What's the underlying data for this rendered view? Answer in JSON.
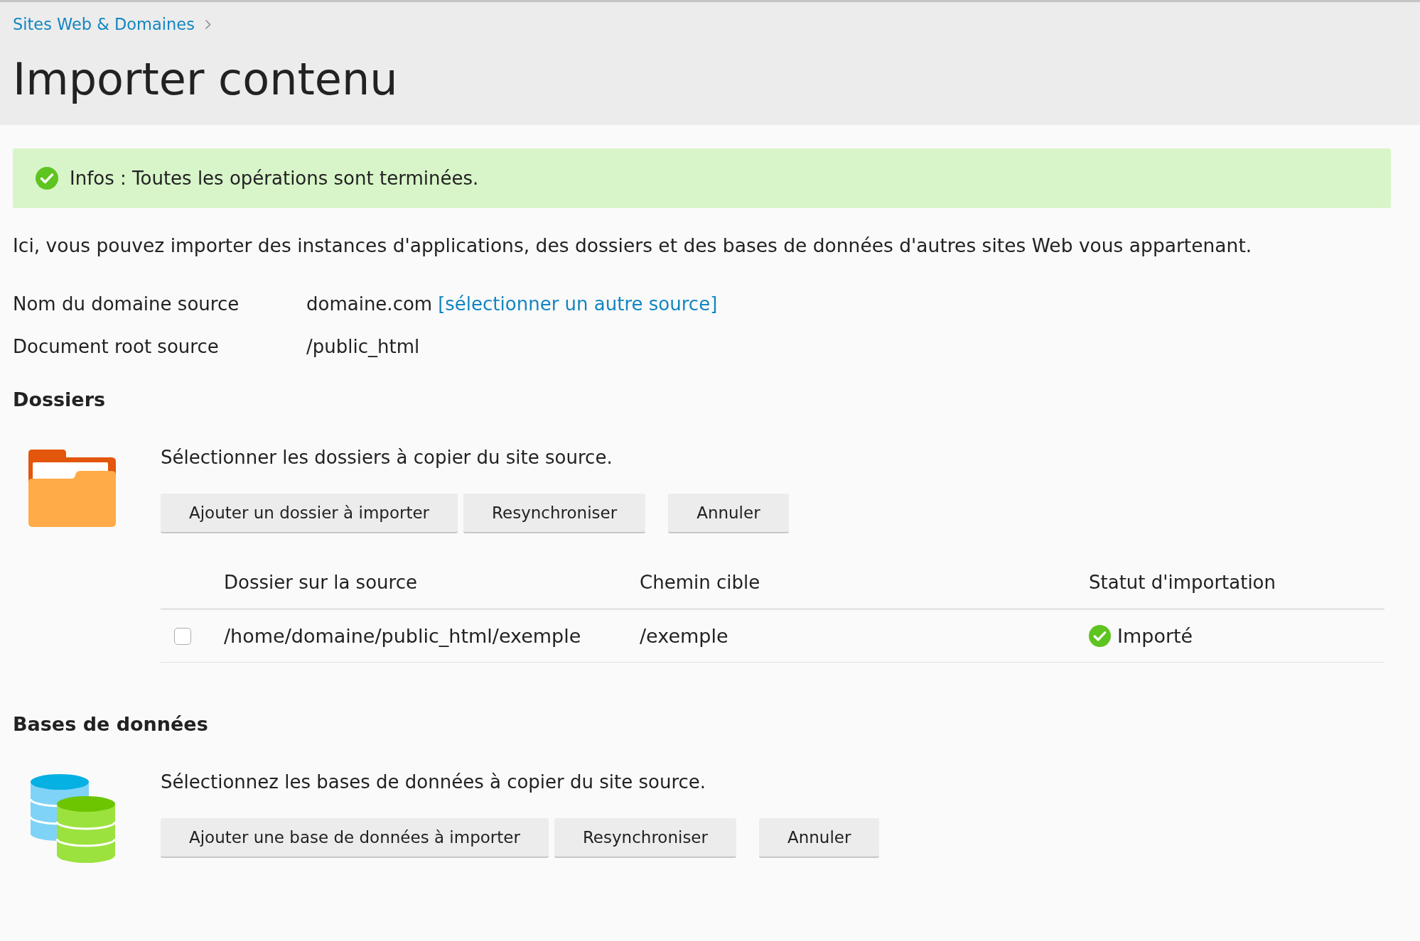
{
  "breadcrumb": [
    {
      "label": "Sites Web & Domaines"
    }
  ],
  "page_title": "Importer contenu",
  "alert": {
    "kind": "success",
    "text": "Infos : Toutes les opérations sont terminées."
  },
  "intro": "Ici, vous pouvez importer des instances d'applications, des dossiers et des bases de données d'autres sites Web vous appartenant.",
  "source_details": [
    {
      "label": "Nom du domaine source",
      "value": "domaine.com",
      "link": "[sélectionner un autre source]"
    },
    {
      "label": "Document root source",
      "value": "/public_html"
    }
  ],
  "sections": [
    {
      "kind": "folders",
      "title": "Dossiers",
      "description": "Sélectionner les dossiers à copier du site source.",
      "buttons": [
        "Ajouter un dossier à importer",
        "Resynchroniser"
      ],
      "cancel_button": "Annuler",
      "table": {
        "columns": [
          "Dossier sur la source",
          "Chemin cible",
          "Statut d'importation"
        ],
        "rows": [
          {
            "checked": false,
            "source": "/home/domaine/public_html/exemple",
            "target": "/exemple",
            "status": {
              "kind": "success",
              "text": "Importé"
            }
          }
        ]
      }
    },
    {
      "kind": "databases",
      "title": "Bases de données",
      "description": "Sélectionnez les bases de données à copier du site source.",
      "buttons": [
        "Ajouter une base de données à importer",
        "Resynchroniser"
      ],
      "cancel_button": "Annuler"
    }
  ]
}
